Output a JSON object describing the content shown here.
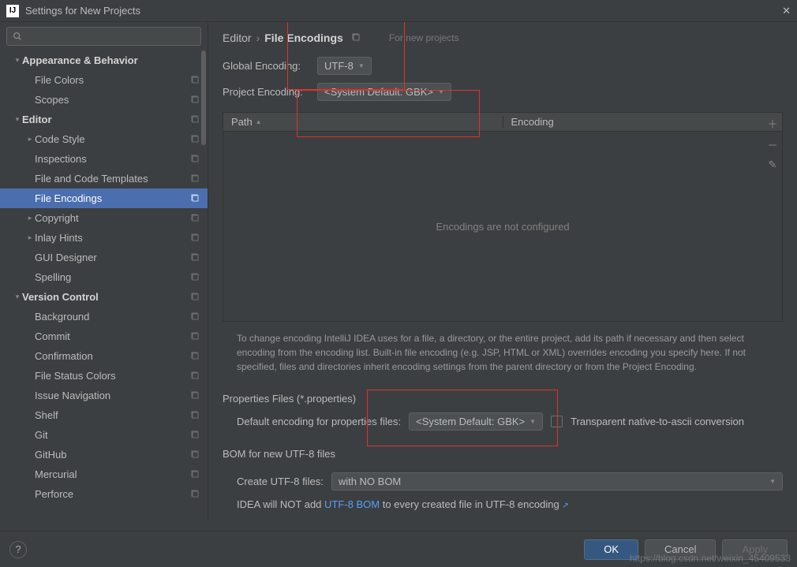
{
  "window": {
    "title": "Settings for New Projects"
  },
  "search": {
    "placeholder": ""
  },
  "sidebar": {
    "items": [
      {
        "label": "Appearance & Behavior",
        "indent": 1,
        "arrow": "▾",
        "bold": true,
        "copy": false
      },
      {
        "label": "File Colors",
        "indent": 3,
        "arrow": "",
        "bold": false,
        "copy": true
      },
      {
        "label": "Scopes",
        "indent": 3,
        "arrow": "",
        "bold": false,
        "copy": true
      },
      {
        "label": "Editor",
        "indent": 1,
        "arrow": "▾",
        "bold": true,
        "copy": true
      },
      {
        "label": "Code Style",
        "indent": 2,
        "arrow": "▸",
        "bold": false,
        "copy": true
      },
      {
        "label": "Inspections",
        "indent": 3,
        "arrow": "",
        "bold": false,
        "copy": true
      },
      {
        "label": "File and Code Templates",
        "indent": 3,
        "arrow": "",
        "bold": false,
        "copy": true
      },
      {
        "label": "File Encodings",
        "indent": 3,
        "arrow": "",
        "bold": false,
        "copy": true,
        "selected": true
      },
      {
        "label": "Copyright",
        "indent": 2,
        "arrow": "▸",
        "bold": false,
        "copy": true
      },
      {
        "label": "Inlay Hints",
        "indent": 2,
        "arrow": "▸",
        "bold": false,
        "copy": true
      },
      {
        "label": "GUI Designer",
        "indent": 3,
        "arrow": "",
        "bold": false,
        "copy": true
      },
      {
        "label": "Spelling",
        "indent": 3,
        "arrow": "",
        "bold": false,
        "copy": true
      },
      {
        "label": "Version Control",
        "indent": 1,
        "arrow": "▾",
        "bold": true,
        "copy": true
      },
      {
        "label": "Background",
        "indent": 3,
        "arrow": "",
        "bold": false,
        "copy": true
      },
      {
        "label": "Commit",
        "indent": 3,
        "arrow": "",
        "bold": false,
        "copy": true
      },
      {
        "label": "Confirmation",
        "indent": 3,
        "arrow": "",
        "bold": false,
        "copy": true
      },
      {
        "label": "File Status Colors",
        "indent": 3,
        "arrow": "",
        "bold": false,
        "copy": true
      },
      {
        "label": "Issue Navigation",
        "indent": 3,
        "arrow": "",
        "bold": false,
        "copy": true
      },
      {
        "label": "Shelf",
        "indent": 3,
        "arrow": "",
        "bold": false,
        "copy": true
      },
      {
        "label": "Git",
        "indent": 3,
        "arrow": "",
        "bold": false,
        "copy": true
      },
      {
        "label": "GitHub",
        "indent": 3,
        "arrow": "",
        "bold": false,
        "copy": true
      },
      {
        "label": "Mercurial",
        "indent": 3,
        "arrow": "",
        "bold": false,
        "copy": true
      },
      {
        "label": "Perforce",
        "indent": 3,
        "arrow": "",
        "bold": false,
        "copy": true
      }
    ]
  },
  "breadcrumb": {
    "parent": "Editor",
    "current": "File Encodings",
    "meta": "For new projects"
  },
  "globalEncoding": {
    "label": "Global Encoding:",
    "value": "UTF-8"
  },
  "projectEncoding": {
    "label": "Project Encoding:",
    "value": "<System Default: GBK>"
  },
  "table": {
    "col1": "Path",
    "col2": "Encoding",
    "empty": "Encodings are not configured"
  },
  "helpText": "To change encoding IntelliJ IDEA uses for a file, a directory, or the entire project, add its path if necessary and then select encoding from the encoding list. Built-in file encoding (e.g. JSP, HTML or XML) overrides encoding you specify here. If not specified, files and directories inherit encoding settings from the parent directory or from the Project Encoding.",
  "properties": {
    "title": "Properties Files (*.properties)",
    "label": "Default encoding for properties files:",
    "value": "<System Default: GBK>",
    "checkbox": "Transparent native-to-ascii conversion"
  },
  "bom": {
    "title": "BOM for new UTF-8 files",
    "label": "Create UTF-8 files:",
    "value": "with NO BOM",
    "text1": "IDEA will NOT add ",
    "link": "UTF-8 BOM",
    "text2": " to every created file in UTF-8 encoding "
  },
  "footer": {
    "ok": "OK",
    "cancel": "Cancel",
    "apply": "Apply"
  },
  "watermark": "https://blog.csdn.net/weixin_45409533"
}
